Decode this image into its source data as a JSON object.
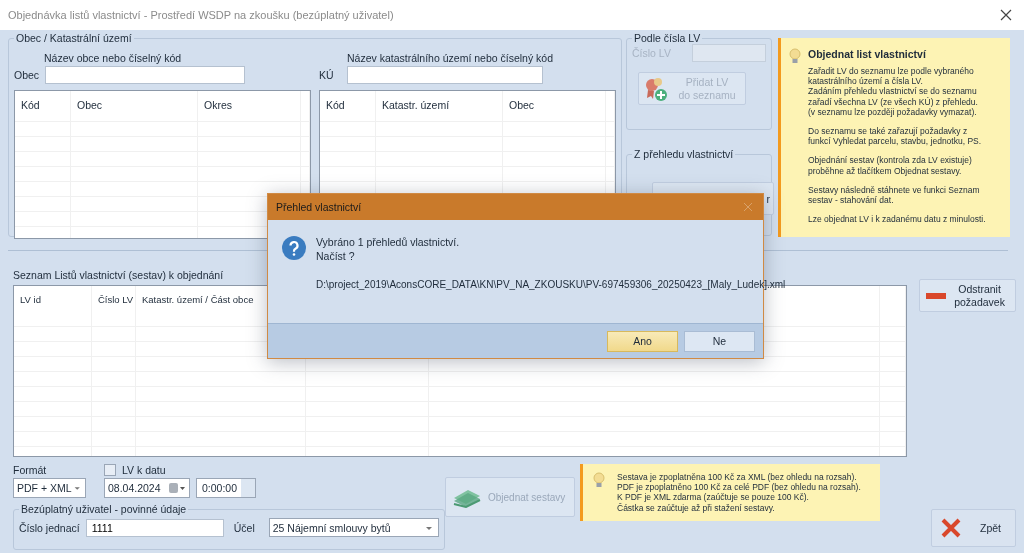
{
  "window": {
    "title": "Objednávka listů vlastnictví  - Prostředí WSDP na zkoušku (bezúplatný uživatel)"
  },
  "obec_group": {
    "title": "Obec / Katastrální území",
    "obec_hint": "Název obce nebo číselný kód",
    "obec_label": "Obec",
    "ku_hint": "Název katastrálního území nebo číselný kód",
    "ku_label": "KÚ",
    "obec_table": {
      "columns": [
        "Kód",
        "Obec",
        "Okres"
      ]
    },
    "ku_table": {
      "columns": [
        "Kód",
        "Katastr. území",
        "Obec"
      ]
    }
  },
  "lv_group": {
    "title": "Podle čísla LV",
    "field_label": "Číslo LV",
    "disabled": true,
    "add_button": "Přidat LV\ndo seznamu"
  },
  "prehled_group": {
    "title": "Z přehledu vlastnictví",
    "button_label": "r"
  },
  "info": {
    "title": "Objednat list vlastnictví",
    "paragraphs": [
      "Zařadit LV do seznamu lze podle vybraného\nkatastrálního území a čísla LV.\nZadáním přehledu vlastnictví se do seznamu\nzařadí všechna LV (ze všech KÚ) z přehledu.\n(v seznamu lze později požadavky vymazat).",
      "Do seznamu se také zařazují požadavky z\nfunkcí Vyhledat parcelu, stavbu, jednotku, PS.",
      "Objednání sestav (kontrola zda LV existuje)\nproběhne až tlačítkem Objednat sestavy.",
      "Sestavy následně stáhnete ve funkci Seznam\nsestav - stahování dat.",
      "Lze objednat LV i k zadanému datu z minulosti."
    ]
  },
  "order_list": {
    "title": "Seznam Listů vlastnictví (sestav) k objednání",
    "columns": [
      "LV id",
      "Číslo LV",
      "Katastr. území / Část obce"
    ]
  },
  "remove_button": "Odstranit\npožadavek",
  "format": {
    "label": "Formát",
    "value": "PDF + XML"
  },
  "date_filter": {
    "label": "LV k datu",
    "checked": false,
    "date": "08.04.2024",
    "time": "0:00:00"
  },
  "free_user": {
    "title": "Bezúplatný uživatel - povinné údaje",
    "ref_label": "Číslo jednací",
    "ref_value": "1111",
    "purpose_label": "Účel",
    "purpose_value": "25  Nájemní smlouvy bytů"
  },
  "order_button": {
    "label": "Objednat sestavy",
    "disabled": true
  },
  "fee_note": "Sestava je zpoplatněna 100 Kč za XML (bez ohledu na rozsah).\nPDF je zpoplatněno 100 Kč za celé PDF (bez ohledu na rozsah).\nK PDF je XML zdarma (zaúčtuje se pouze 100 Kč).\nČástka se zaúčtuje až při stažení sestavy.",
  "back_button": "Zpět",
  "dialog": {
    "title": "Přehled vlastnictví",
    "message": "Vybráno  1  přehledů vlastnictví.\nNačíst ?",
    "path": "D:\\project_2019\\AconsCORE_DATA\\KN\\PV_NA_ZKOUSKU\\PV-697459306_20250423_[Maly_Ludek].xml",
    "buttons": [
      {
        "label": "Ano",
        "selected": true
      },
      {
        "label": "Ne",
        "selected": false
      }
    ]
  }
}
